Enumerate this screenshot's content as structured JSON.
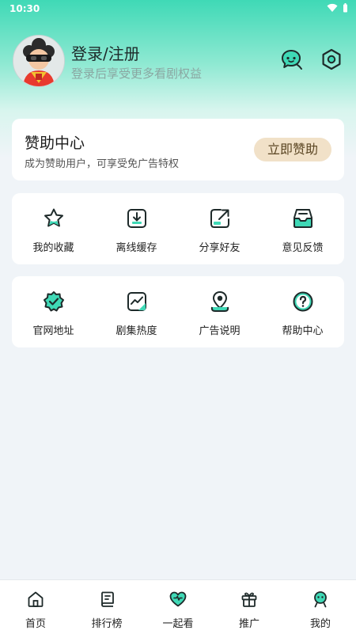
{
  "status_bar": {
    "time": "10:30"
  },
  "profile": {
    "title": "登录/注册",
    "subtitle": "登录后享受更多看剧权益"
  },
  "header_icons": [
    "message-icon",
    "settings-icon"
  ],
  "sponsor": {
    "title": "赞助中心",
    "subtitle": "成为赞助用户，可享受免广告特权",
    "button": "立即赞助"
  },
  "grid1": [
    {
      "label": "我的收藏",
      "icon": "star-icon"
    },
    {
      "label": "离线缓存",
      "icon": "download-icon"
    },
    {
      "label": "分享好友",
      "icon": "share-icon"
    },
    {
      "label": "意见反馈",
      "icon": "inbox-icon"
    }
  ],
  "grid2": [
    {
      "label": "官网地址",
      "icon": "badge-check-icon"
    },
    {
      "label": "剧集热度",
      "icon": "trend-chart-icon"
    },
    {
      "label": "广告说明",
      "icon": "location-pin-icon"
    },
    {
      "label": "帮助中心",
      "icon": "question-icon"
    }
  ],
  "tabbar": [
    {
      "label": "首页",
      "icon": "home-icon"
    },
    {
      "label": "排行榜",
      "icon": "ranking-icon"
    },
    {
      "label": "一起看",
      "icon": "heart-icon"
    },
    {
      "label": "推广",
      "icon": "gift-icon"
    },
    {
      "label": "我的",
      "icon": "profile-icon"
    }
  ],
  "colors": {
    "accent": "#3fd9b6",
    "dark_stroke": "#1e2a2a",
    "sponsor_button_bg": "#f1e1c8"
  }
}
